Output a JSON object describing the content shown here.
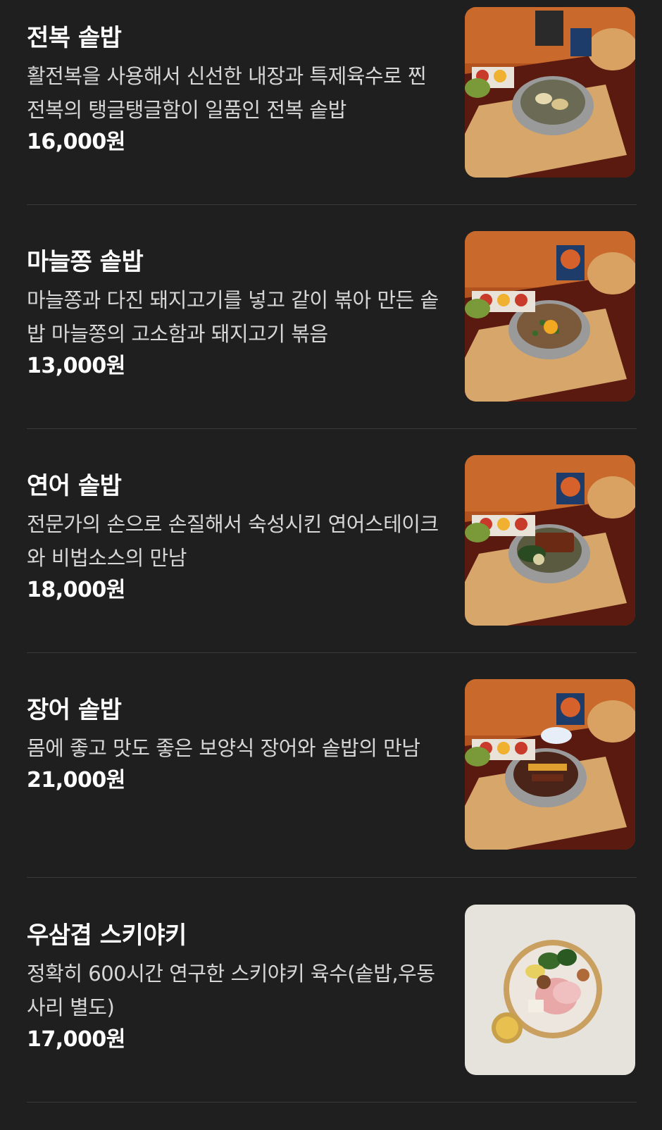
{
  "menu": {
    "items": [
      {
        "name": "전복 솥밥",
        "description": "활전복을 사용해서 신선한 내장과 특제육수로 찐 전복의 탱글탱글함이 일품인 전복 솥밥",
        "price": "16,000원",
        "image_icon": "abalone-sotbap-photo"
      },
      {
        "name": "마늘쫑 솥밥",
        "description": "마늘쫑과 다진 돼지고기를 넣고 같이 볶아 만든 솥밥 마늘쫑의 고소함과 돼지고기 볶음",
        "price": "13,000원",
        "image_icon": "garlic-stem-sotbap-photo"
      },
      {
        "name": "연어 솥밥",
        "description": "전문가의 손으로 손질해서 숙성시킨 연어스테이크와 비법소스의 만남",
        "price": "18,000원",
        "image_icon": "salmon-sotbap-photo"
      },
      {
        "name": "장어 솥밥",
        "description": "몸에 좋고 맛도 좋은 보양식 장어와 솥밥의 만남",
        "price": "21,000원",
        "image_icon": "eel-sotbap-photo"
      },
      {
        "name": "우삼겹 스키야키",
        "description": "정확히 600시간 연구한 스키야키 육수(솥밥,우동사리 별도)",
        "price": "17,000원",
        "image_icon": "beef-sukiyaki-photo"
      }
    ]
  },
  "colors": {
    "background": "#1f1f1f",
    "divider": "#3a3a3a",
    "text_primary": "#ffffff",
    "text_secondary": "#d6d6d6"
  }
}
